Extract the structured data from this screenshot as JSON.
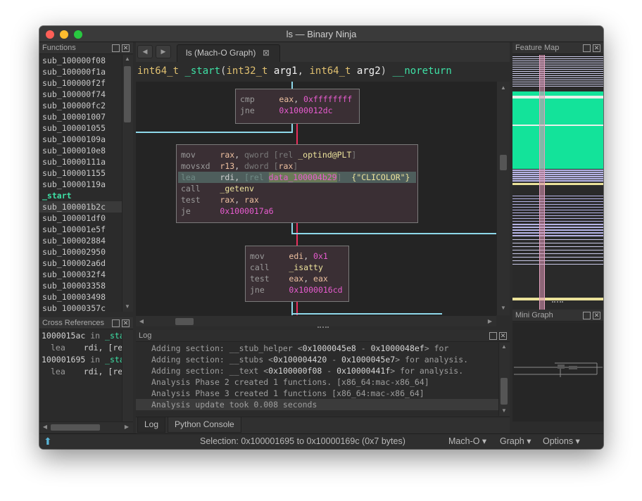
{
  "window": {
    "title": "ls — Binary Ninja"
  },
  "functions_panel": {
    "title": "Functions",
    "items": [
      "sub_100000f08",
      "sub_100000f1a",
      "sub_100000f2f",
      "sub_100000f74",
      "sub_100000fc2",
      "sub_100001007",
      "sub_100001055",
      "sub_10000109a",
      "sub_1000010e8",
      "sub_10000111a",
      "sub_100001155",
      "sub_10000119a",
      "_start",
      "sub_100001b2c",
      "sub_100001df0",
      "sub_100001e5f",
      "sub_100002884",
      "sub_100002950",
      "sub_100002a6d",
      "sub_1000032f4",
      "sub_100003358",
      "sub_100003498",
      "sub_10000357c"
    ]
  },
  "xref_panel": {
    "title": "Cross References",
    "rows": [
      {
        "addr": "1000015ac",
        "in": " in ",
        "fn": "_start"
      },
      {
        "op": "lea",
        "arg": "rdi, [re"
      },
      {
        "addr": "100001695",
        "in": " in ",
        "fn": "_start"
      },
      {
        "op": "lea",
        "arg": "rdi, [re"
      }
    ]
  },
  "tab": {
    "label": "ls (Mach-O Graph)",
    "close": "⊠",
    "nav_back": "◀",
    "nav_fwd": "▶"
  },
  "signature": {
    "ret": "int64_t ",
    "name": "_start",
    "open": "(",
    "t1": "int32_t ",
    "a1": "arg1",
    "sep": ", ",
    "t2": "int64_t ",
    "a2": "arg2",
    "close": ") ",
    "attr": "__noreturn"
  },
  "graph": {
    "block1": [
      {
        "op": "cmp",
        "pad": "     ",
        "r1": "eax",
        "c": ", ",
        "h": "0xffffffff"
      },
      {
        "op": "jne",
        "pad": "     ",
        "h": "0x1000012dc"
      }
    ],
    "block2": [
      {
        "op": "mov",
        "pad": "     ",
        "r1": "rax",
        "c": ", ",
        "g1": "qword [rel ",
        "s": "_optind@PLT",
        "g2": "]"
      },
      {
        "op": "movsxd",
        "pad": "  ",
        "r1": "r13",
        "c": ", ",
        "g1": "dword [",
        "r2": "rax",
        "g2": "]"
      },
      {
        "op": "lea",
        "pad": "     ",
        "r1": "rdi",
        "c": ", ",
        "g1": "[rel ",
        "d": "data_100004b29",
        "g2": "]  ",
        "str": "{\"CLICOLOR\"}"
      },
      {
        "op": "call",
        "pad": "    ",
        "s": "_getenv"
      },
      {
        "op": "test",
        "pad": "    ",
        "r1": "rax",
        "c": ", ",
        "r2": "rax"
      },
      {
        "op": "je",
        "pad": "      ",
        "h": "0x1000017a6"
      }
    ],
    "block3": [
      {
        "op": "mov",
        "pad": "     ",
        "r1": "edi",
        "c": ", ",
        "h": "0x1"
      },
      {
        "op": "call",
        "pad": "    ",
        "s": "_isatty"
      },
      {
        "op": "test",
        "pad": "    ",
        "r1": "eax",
        "c": ", ",
        "r2": "eax"
      },
      {
        "op": "jne",
        "pad": "     ",
        "h": "0x1000016cd"
      }
    ]
  },
  "log_panel": {
    "title": "Log",
    "lines": [
      {
        "a": "Adding section: __stub_helper <",
        "b": "0x1000045e8",
        "c": " - ",
        "d": "0x1000048ef",
        "e": "> for"
      },
      {
        "a": "Adding section: __stubs <",
        "b": "0x100004420",
        "c": " - ",
        "d": "0x1000045e7",
        "e": "> for analysis."
      },
      {
        "a": "Adding section: __text <",
        "b": "0x100000f08",
        "c": " - ",
        "d": "0x10000441f",
        "e": "> for analysis."
      },
      {
        "a": "Analysis Phase 2 created 1 functions. [x86_64:mac-x86_64]",
        "b": "",
        "c": "",
        "d": "",
        "e": ""
      },
      {
        "a": "Analysis Phase 3 created 1 functions [x86_64:mac-x86_64]",
        "b": "",
        "c": "",
        "d": "",
        "e": ""
      },
      {
        "a": "Analysis update took 0.008 seconds",
        "b": "",
        "c": "",
        "d": "",
        "e": ""
      }
    ]
  },
  "bottom_tabs": {
    "log": "Log",
    "python": "Python Console"
  },
  "feature_map": {
    "title": "Feature Map"
  },
  "mini_graph": {
    "title": "Mini Graph"
  },
  "status": {
    "selection": "Selection: 0x100001695 to 0x10000169c (0x7 bytes)",
    "format": "Mach-O ▾",
    "view": "Graph ▾",
    "options": "Options ▾"
  },
  "colors": {
    "accent": "#3ee0a5",
    "hex": "#e85cd0",
    "symbol": "#ede39c",
    "edge_true": "#e9305e",
    "edge_false": "#8ed8ea"
  }
}
